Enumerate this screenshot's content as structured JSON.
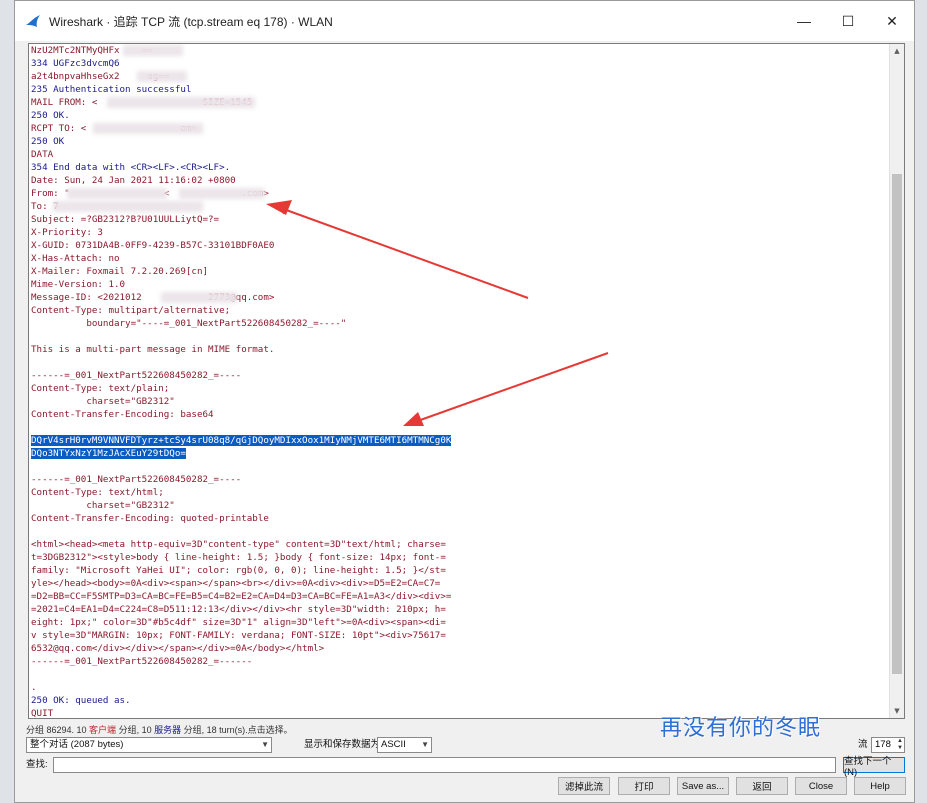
{
  "window": {
    "title": "Wireshark · 追踪 TCP 流 (tcp.stream eq 178) · WLAN",
    "minimize": "—",
    "maximize": "☐",
    "close": "✕"
  },
  "stream_lines": [
    {
      "t": "NzU2MTc2NTMyQHFx    ==",
      "k": "c"
    },
    {
      "t": "334 UGFzc3dvcmQ6",
      "k": "s"
    },
    {
      "t": "a2t4bnpvaHhseGx2     ag==",
      "k": "c"
    },
    {
      "t": "235 Authentication successful",
      "k": "s"
    },
    {
      "t": "MAIL FROM: <                   SIZE=1545",
      "k": "c"
    },
    {
      "t": "250 OK.",
      "k": "s"
    },
    {
      "t": "RCPT TO: <                 om>",
      "k": "c"
    },
    {
      "t": "250 OK",
      "k": "s"
    },
    {
      "t": "DATA",
      "k": "c"
    },
    {
      "t": "354 End data with <CR><LF>.<CR><LF>.",
      "k": "s"
    },
    {
      "t": "Date: Sun, 24 Jan 2021 11:16:02 +0800",
      "k": "c"
    },
    {
      "t": "From: \"                 <             .com>",
      "k": "c"
    },
    {
      "t": "To: 7               ",
      "k": "c"
    },
    {
      "t": "Subject: =?GB2312?B?U01UULLiytQ=?=",
      "k": "c"
    },
    {
      "t": "X-Priority: 3",
      "k": "c"
    },
    {
      "t": "X-GUID: 0731DA4B-0FF9-4239-B57C-33101BDF0AE0",
      "k": "c"
    },
    {
      "t": "X-Has-Attach: no",
      "k": "c"
    },
    {
      "t": "X-Mailer: Foxmail 7.2.20.269[cn]",
      "k": "c"
    },
    {
      "t": "Mime-Version: 1.0",
      "k": "c"
    },
    {
      "t": "Message-ID: <2021012            2773@qq.com>",
      "k": "c"
    },
    {
      "t": "Content-Type: multipart/alternative;",
      "k": "c"
    },
    {
      "t": "          boundary=\"----=_001_NextPart522608450282_=----\"",
      "k": "c"
    },
    {
      "t": "",
      "k": "c"
    },
    {
      "t": "This is a multi-part message in MIME format.",
      "k": "c"
    },
    {
      "t": "",
      "k": "c"
    },
    {
      "t": "------=_001_NextPart522608450282_=----",
      "k": "c"
    },
    {
      "t": "Content-Type: text/plain;",
      "k": "c"
    },
    {
      "t": "          charset=\"GB2312\"",
      "k": "c"
    },
    {
      "t": "Content-Transfer-Encoding: base64",
      "k": "c"
    },
    {
      "t": "",
      "k": "c"
    },
    {
      "t": "DQrV4srH0rvM9VNNVFDTyrz+tcSy4srU08q8/qGjDQoyMDIxxOox1MIyNMjVMTE6MTI6MTMNCg0K",
      "k": "sel"
    },
    {
      "t": "DQo3NTYxNzY1MzJAcXEuY29tDQo=",
      "k": "sel"
    },
    {
      "t": "",
      "k": "c"
    },
    {
      "t": "------=_001_NextPart522608450282_=----",
      "k": "c"
    },
    {
      "t": "Content-Type: text/html;",
      "k": "c"
    },
    {
      "t": "          charset=\"GB2312\"",
      "k": "c"
    },
    {
      "t": "Content-Transfer-Encoding: quoted-printable",
      "k": "c"
    },
    {
      "t": "",
      "k": "c"
    },
    {
      "t": "<html><head><meta http-equiv=3D\"content-type\" content=3D\"text/html; charse=",
      "k": "c"
    },
    {
      "t": "t=3DGB2312\"><style>body { line-height: 1.5; }body { font-size: 14px; font-=",
      "k": "c"
    },
    {
      "t": "family: \"Microsoft YaHei UI\"; color: rgb(0, 0, 0); line-height: 1.5; }</st=",
      "k": "c"
    },
    {
      "t": "yle></head><body>=0A<div><span></span><br></div>=0A<div><div>=D5=E2=CA=C7=",
      "k": "c"
    },
    {
      "t": "=D2=BB=CC=F5SMTP=D3=CA=BC=FE=B5=C4=B2=E2=CA=D4=D3=CA=BC=FE=A1=A3</div><div>=",
      "k": "c"
    },
    {
      "t": "=2021=C4=EA1=D4=C224=C8=D511:12:13</div></div><hr style=3D\"width: 210px; h=",
      "k": "c"
    },
    {
      "t": "eight: 1px;\" color=3D\"#b5c4df\" size=3D\"1\" align=3D\"left\">=0A<div><span><di=",
      "k": "c"
    },
    {
      "t": "v style=3D\"MARGIN: 10px; FONT-FAMILY: verdana; FONT-SIZE: 10pt\"><div>75617=",
      "k": "c"
    },
    {
      "t": "6532@qq.com</div></div></span></div>=0A</body></html>",
      "k": "c"
    },
    {
      "t": "------=_001_NextPart522608450282_=------",
      "k": "c"
    },
    {
      "t": "",
      "k": "c"
    },
    {
      "t": ".",
      "k": "c"
    },
    {
      "t": "250 OK: queued as.",
      "k": "s"
    },
    {
      "t": "QUIT",
      "k": "c"
    }
  ],
  "status": {
    "prefix": "分组 86294. 10 ",
    "client_pkts": "客户端",
    "mid": " 分组, 10 ",
    "server_pkts": "服务器",
    "suffix": " 分组, 18 turn(s).点击选择。"
  },
  "controls": {
    "conversation_select": "整个对话 (2087 bytes)",
    "show_save_label": "显示和保存数据为",
    "encoding_select": "ASCII",
    "stream_label": "流",
    "stream_value": "178",
    "find_label": "查找:",
    "find_value": "",
    "find_next_button": "查找下一个(N)",
    "filter_out_button": "滤掉此流",
    "print_button": "打印",
    "save_as_button": "Save as...",
    "back_button": "返回",
    "close_button": "Close",
    "help_button": "Help"
  },
  "watermark": "再没有你的冬眠"
}
